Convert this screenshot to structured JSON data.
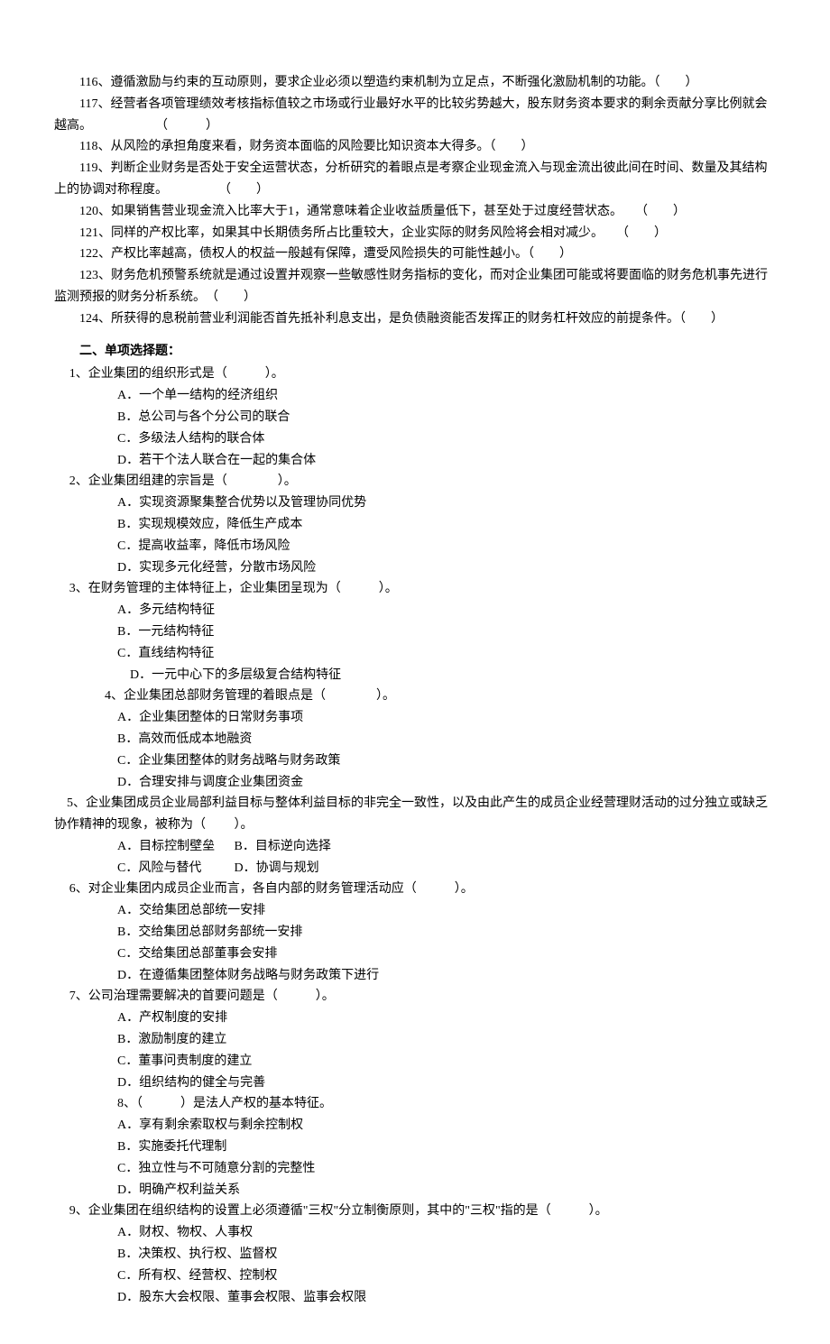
{
  "tf": {
    "q116": "116、遵循激励与约束的互动原则，要求企业必须以塑造约束机制为立足点，不断强化激励机制的功能。（　　）",
    "q117": "　　117、经营者各项管理绩效考核指标值较之市场或行业最好水平的比较劣势越大，股东财务资本要求的剩余贡献分享比例就会越高。　　　　　　（　　　）",
    "q118": "118、从风险的承担角度来看，财务资本面临的风险要比知识资本大得多。（　　）",
    "q119": "　　119、判断企业财务是否处于安全运营状态，分析研究的着眼点是考察企业现金流入与现金流出彼此间在时间、数量及其结构上的协调对称程度。　　　　　（　　）",
    "q120": "120、如果销售营业现金流入比率大于1，通常意味着企业收益质量低下，甚至处于过度经营状态。　　（　　）",
    "q121": "121、同样的产权比率，如果其中长期债务所占比重较大，企业实际的财务风险将会相对减少。　　（　　）",
    "q122": "122、产权比率越高，债权人的权益一般越有保障，遭受风险损失的可能性越小。（　　）",
    "q123": "　　123、财务危机预警系统就是通过设置并观察一些敏感性财务指标的变化，而对企业集团可能或将要面临的财务危机事先进行监测预报的财务分析系统。　（　　）",
    "q124": "124、所获得的息税前营业利润能否首先抵补利息支出，是负债融资能否发挥正的财务杠杆效应的前提条件。（　　）"
  },
  "sectionTitle": "二、单项选择题：",
  "mc": {
    "q1": {
      "stem": "1、企业集团的组织形式是（　　　）。",
      "A": "A．一个单一结构的经济组织",
      "B": "B．总公司与各个分公司的联合",
      "C": "C．多级法人结构的联合体",
      "D": "D．若干个法人联合在一起的集合体"
    },
    "q2": {
      "stem": "2、企业集团组建的宗旨是（　　　　）。",
      "A": "A．实现资源聚集整合优势以及管理协同优势",
      "B": "B．实现规模效应，降低生产成本",
      "C": "C．提高收益率，降低市场风险",
      "D": "D．实现多元化经营，分散市场风险"
    },
    "q3": {
      "stem": "3、在财务管理的主体特征上，企业集团呈现为（　　　）。",
      "A": "A．多元结构特征",
      "B": "B．一元结构特征",
      "C": "C．直线结构特征",
      "D": "　D．一元中心下的多层级复合结构特征"
    },
    "q4": {
      "stem": "　4、企业集团总部财务管理的着眼点是（　　　　）。",
      "A": "A．企业集团整体的日常财务事项",
      "B": "B．高效而低成本地融资",
      "C": "C．企业集团整体的财务战略与财务政策",
      "D": "D．合理安排与调度企业集团资金"
    },
    "q5": {
      "stem": "　5、企业集团成员企业局部利益目标与整体利益目标的非完全一致性，以及由此产生的成员企业经营理财活动的过分独立或缺乏协作精神的现象，被称为（ 　　）。",
      "A": "A．目标控制壁垒",
      "B": "B．目标逆向选择",
      "C": "C．风险与替代",
      "D": "D．协调与规划"
    },
    "q6": {
      "stem": "6、对企业集团内成员企业而言，各自内部的财务管理活动应（　　　）。",
      "A": "A．交给集团总部统一安排",
      "B": "B．交给集团总部财务部统一安排",
      "C": "C．交给集团总部董事会安排",
      "D": "D．在遵循集团整体财务战略与财务政策下进行"
    },
    "q7": {
      "stem": "7、公司治理需要解决的首要问题是（　　　）。",
      "A": "A．产权制度的安排",
      "B": "B．激励制度的建立",
      "C": "C．董事问责制度的建立",
      "D": "D．组织结构的健全与完善"
    },
    "q8": {
      "stem": "8、（　　　）是法人产权的基本特征。",
      "A": "A．享有剩余索取权与剩余控制权",
      "B": "B．实施委托代理制",
      "C": "C．独立性与不可随意分割的完整性",
      "D": "D．明确产权利益关系"
    },
    "q9": {
      "stem": "9、企业集团在组织结构的设置上必须遵循\"三权\"分立制衡原则，其中的\"三权\"指的是（　　　）。",
      "A": "A．财权、物权、人事权",
      "B": "B．决策权、执行权、监督权",
      "C": "C．所有权、经营权、控制权",
      "D": "D．股东大会权限、董事会权限、监事会权限"
    }
  }
}
